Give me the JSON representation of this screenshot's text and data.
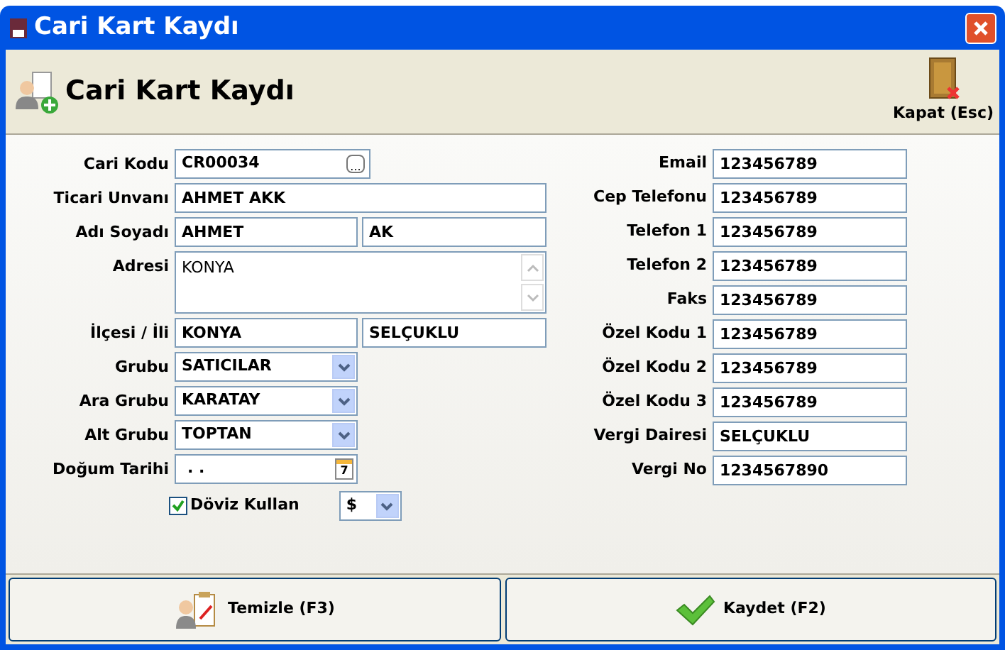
{
  "window": {
    "title": "Cari Kart Kaydı"
  },
  "header": {
    "title": "Cari Kart Kaydı",
    "close_label": "Kapat (Esc)"
  },
  "left_fields": [
    {
      "label": "Cari Kodu",
      "kind": "lookup",
      "value": "CR00034",
      "glyph": "..."
    },
    {
      "label": "Ticari Unvanı",
      "kind": "text",
      "value": "AHMET AKK"
    },
    {
      "label": "Adı Soyadı",
      "kind": "pair",
      "value": "AHMET",
      "value2": "AK"
    },
    {
      "label": "Adresi",
      "kind": "memo",
      "value": "KONYA"
    },
    {
      "label": "İlçesi / İli",
      "kind": "pair",
      "value": "KONYA",
      "value2": "SELÇUKLU"
    },
    {
      "label": "Grubu",
      "kind": "combo",
      "value": "SATICILAR"
    },
    {
      "label": "Ara Grubu",
      "kind": "combo",
      "value": "KARATAY"
    },
    {
      "label": "Alt Grubu",
      "kind": "combo",
      "value": "TOPTAN"
    },
    {
      "label": "Doğum Tarihi",
      "kind": "date",
      "value": ". .",
      "glyph": "7"
    }
  ],
  "currency": {
    "label": "Döviz Kullan",
    "checked": true,
    "value": "$"
  },
  "right_fields": [
    {
      "label": "Email",
      "value": "123456789"
    },
    {
      "label": "Cep Telefonu",
      "value": "123456789"
    },
    {
      "label": "Telefon 1",
      "value": "123456789"
    },
    {
      "label": "Telefon 2",
      "value": "123456789"
    },
    {
      "label": "Faks",
      "value": "123456789"
    },
    {
      "label": "Özel Kodu 1",
      "value": "123456789"
    },
    {
      "label": "Özel Kodu 2",
      "value": "123456789"
    },
    {
      "label": "Özel Kodu 3",
      "value": "123456789"
    },
    {
      "label": "Vergi Dairesi",
      "value": "SELÇUKLU"
    },
    {
      "label": "Vergi No",
      "value": "1234567890"
    }
  ],
  "buttons": [
    {
      "label": "Temizle (F3)",
      "kind": "clear"
    },
    {
      "label": "Kaydet (F2)",
      "kind": "save"
    }
  ]
}
